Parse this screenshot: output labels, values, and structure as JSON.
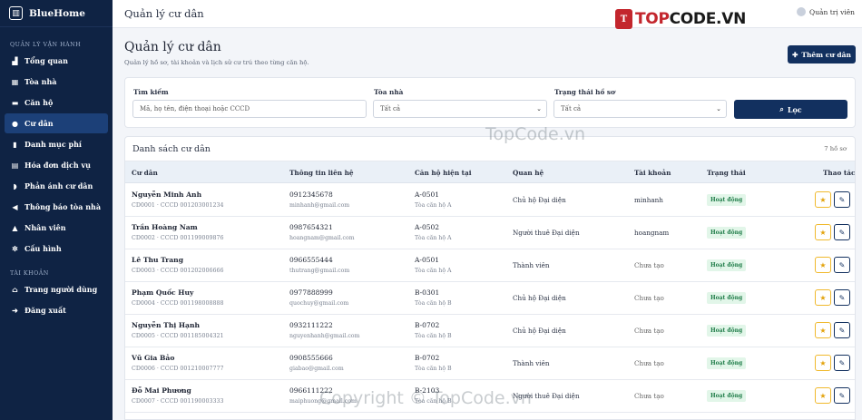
{
  "brand": {
    "name": "BlueHome",
    "logo_icon": "building-icon"
  },
  "sidebar": {
    "section_ops": "QUẢN LÝ VẬN HÀNH",
    "items": [
      {
        "label": "Tổng quan",
        "icon": "chart-icon"
      },
      {
        "label": "Tòa nhà",
        "icon": "building-icon"
      },
      {
        "label": "Căn hộ",
        "icon": "bed-icon"
      },
      {
        "label": "Cư dân",
        "icon": "users-icon"
      },
      {
        "label": "Danh mục phí",
        "icon": "file-icon"
      },
      {
        "label": "Hóa đơn dịch vụ",
        "icon": "invoice-icon"
      },
      {
        "label": "Phản ánh cư dân",
        "icon": "comments-icon"
      },
      {
        "label": "Thông báo tòa nhà",
        "icon": "megaphone-icon"
      },
      {
        "label": "Nhân viên",
        "icon": "user-tie-icon"
      },
      {
        "label": "Cấu hình",
        "icon": "gear-icon"
      }
    ],
    "section_account": "TÀI KHOẢN",
    "account_items": [
      {
        "label": "Trang người dùng",
        "icon": "home-icon"
      },
      {
        "label": "Đăng xuất",
        "icon": "logout-icon"
      }
    ]
  },
  "topbar": {
    "title": "Quản lý cư dân",
    "user": "Quản trị viên"
  },
  "logo_watermark": {
    "prefix": "TOP",
    "suffix": "CODE.VN"
  },
  "page": {
    "title": "Quản lý cư dân",
    "subtitle": "Quản lý hồ sơ, tài khoản và lịch sử cư trú theo từng căn hộ.",
    "add_button": "Thêm cư dân"
  },
  "filters": {
    "search_label": "Tìm kiếm",
    "search_placeholder": "Mã, họ tên, điện thoại hoặc CCCD",
    "building_label": "Tòa nhà",
    "building_value": "Tất cả",
    "status_label": "Trạng thái hồ sơ",
    "status_value": "Tất cả",
    "filter_button": "Lọc"
  },
  "list": {
    "title": "Danh sách cư dân",
    "count": "7 hồ sơ",
    "columns": [
      "Cư dân",
      "Thông tin liên hệ",
      "Căn hộ hiện tại",
      "Quan hệ",
      "Tài khoản",
      "Trạng thái",
      "Thao tác"
    ],
    "rows": [
      {
        "name": "Nguyễn Minh Anh",
        "sub": "CD0001 · CCCD 001203001234",
        "phone": "0912345678",
        "email": "minhanh@gmail.com",
        "apt": "A-0501",
        "bldg": "Tòa căn hộ A",
        "relation": "Chủ hộ  Đại diện",
        "account": "minhanh",
        "status": "Hoạt động"
      },
      {
        "name": "Trần Hoàng Nam",
        "sub": "CD0002 · CCCD 001199009876",
        "phone": "0987654321",
        "email": "hoangnam@gmail.com",
        "apt": "A-0502",
        "bldg": "Tòa căn hộ A",
        "relation": "Người thuê  Đại diện",
        "account": "hoangnam",
        "status": "Hoạt động"
      },
      {
        "name": "Lê Thu Trang",
        "sub": "CD0003 · CCCD 001202006666",
        "phone": "0966555444",
        "email": "thutrang@gmail.com",
        "apt": "A-0501",
        "bldg": "Tòa căn hộ A",
        "relation": "Thành viên",
        "account": "Chưa tạo",
        "status": "Hoạt động"
      },
      {
        "name": "Phạm Quốc Huy",
        "sub": "CD0004 · CCCD 001198008888",
        "phone": "0977888999",
        "email": "quochuy@gmail.com",
        "apt": "B-0301",
        "bldg": "Tòa căn hộ B",
        "relation": "Chủ hộ  Đại diện",
        "account": "Chưa tạo",
        "status": "Hoạt động"
      },
      {
        "name": "Nguyễn Thị Hạnh",
        "sub": "CD0005 · CCCD 001185004321",
        "phone": "0932111222",
        "email": "nguyenhanh@gmail.com",
        "apt": "B-0702",
        "bldg": "Tòa căn hộ B",
        "relation": "Chủ hộ  Đại diện",
        "account": "Chưa tạo",
        "status": "Hoạt động"
      },
      {
        "name": "Vũ Gia Bảo",
        "sub": "CD0006 · CCCD 001210007777",
        "phone": "0908555666",
        "email": "giabao@gmail.com",
        "apt": "B-0702",
        "bldg": "Tòa căn hộ B",
        "relation": "Thành viên",
        "account": "Chưa tạo",
        "status": "Hoạt động"
      },
      {
        "name": "Đỗ Mai Phương",
        "sub": "CD0007 · CCCD 001190003333",
        "phone": "0966111222",
        "email": "maiphuong@gmail.com",
        "apt": "B-2103",
        "bldg": "Tòa căn hộ B",
        "relation": "Người thuê  Đại diện",
        "account": "Chưa tạo",
        "status": "Hoạt động"
      }
    ]
  },
  "watermarks": {
    "mid": "TopCode.vn",
    "bottom": "Copyright © TopCode.vn"
  },
  "colors": {
    "sidebar": "#0f2344",
    "primary": "#12305f",
    "accent_yellow": "#f0b92d",
    "badge_green": "#1b7a45"
  }
}
